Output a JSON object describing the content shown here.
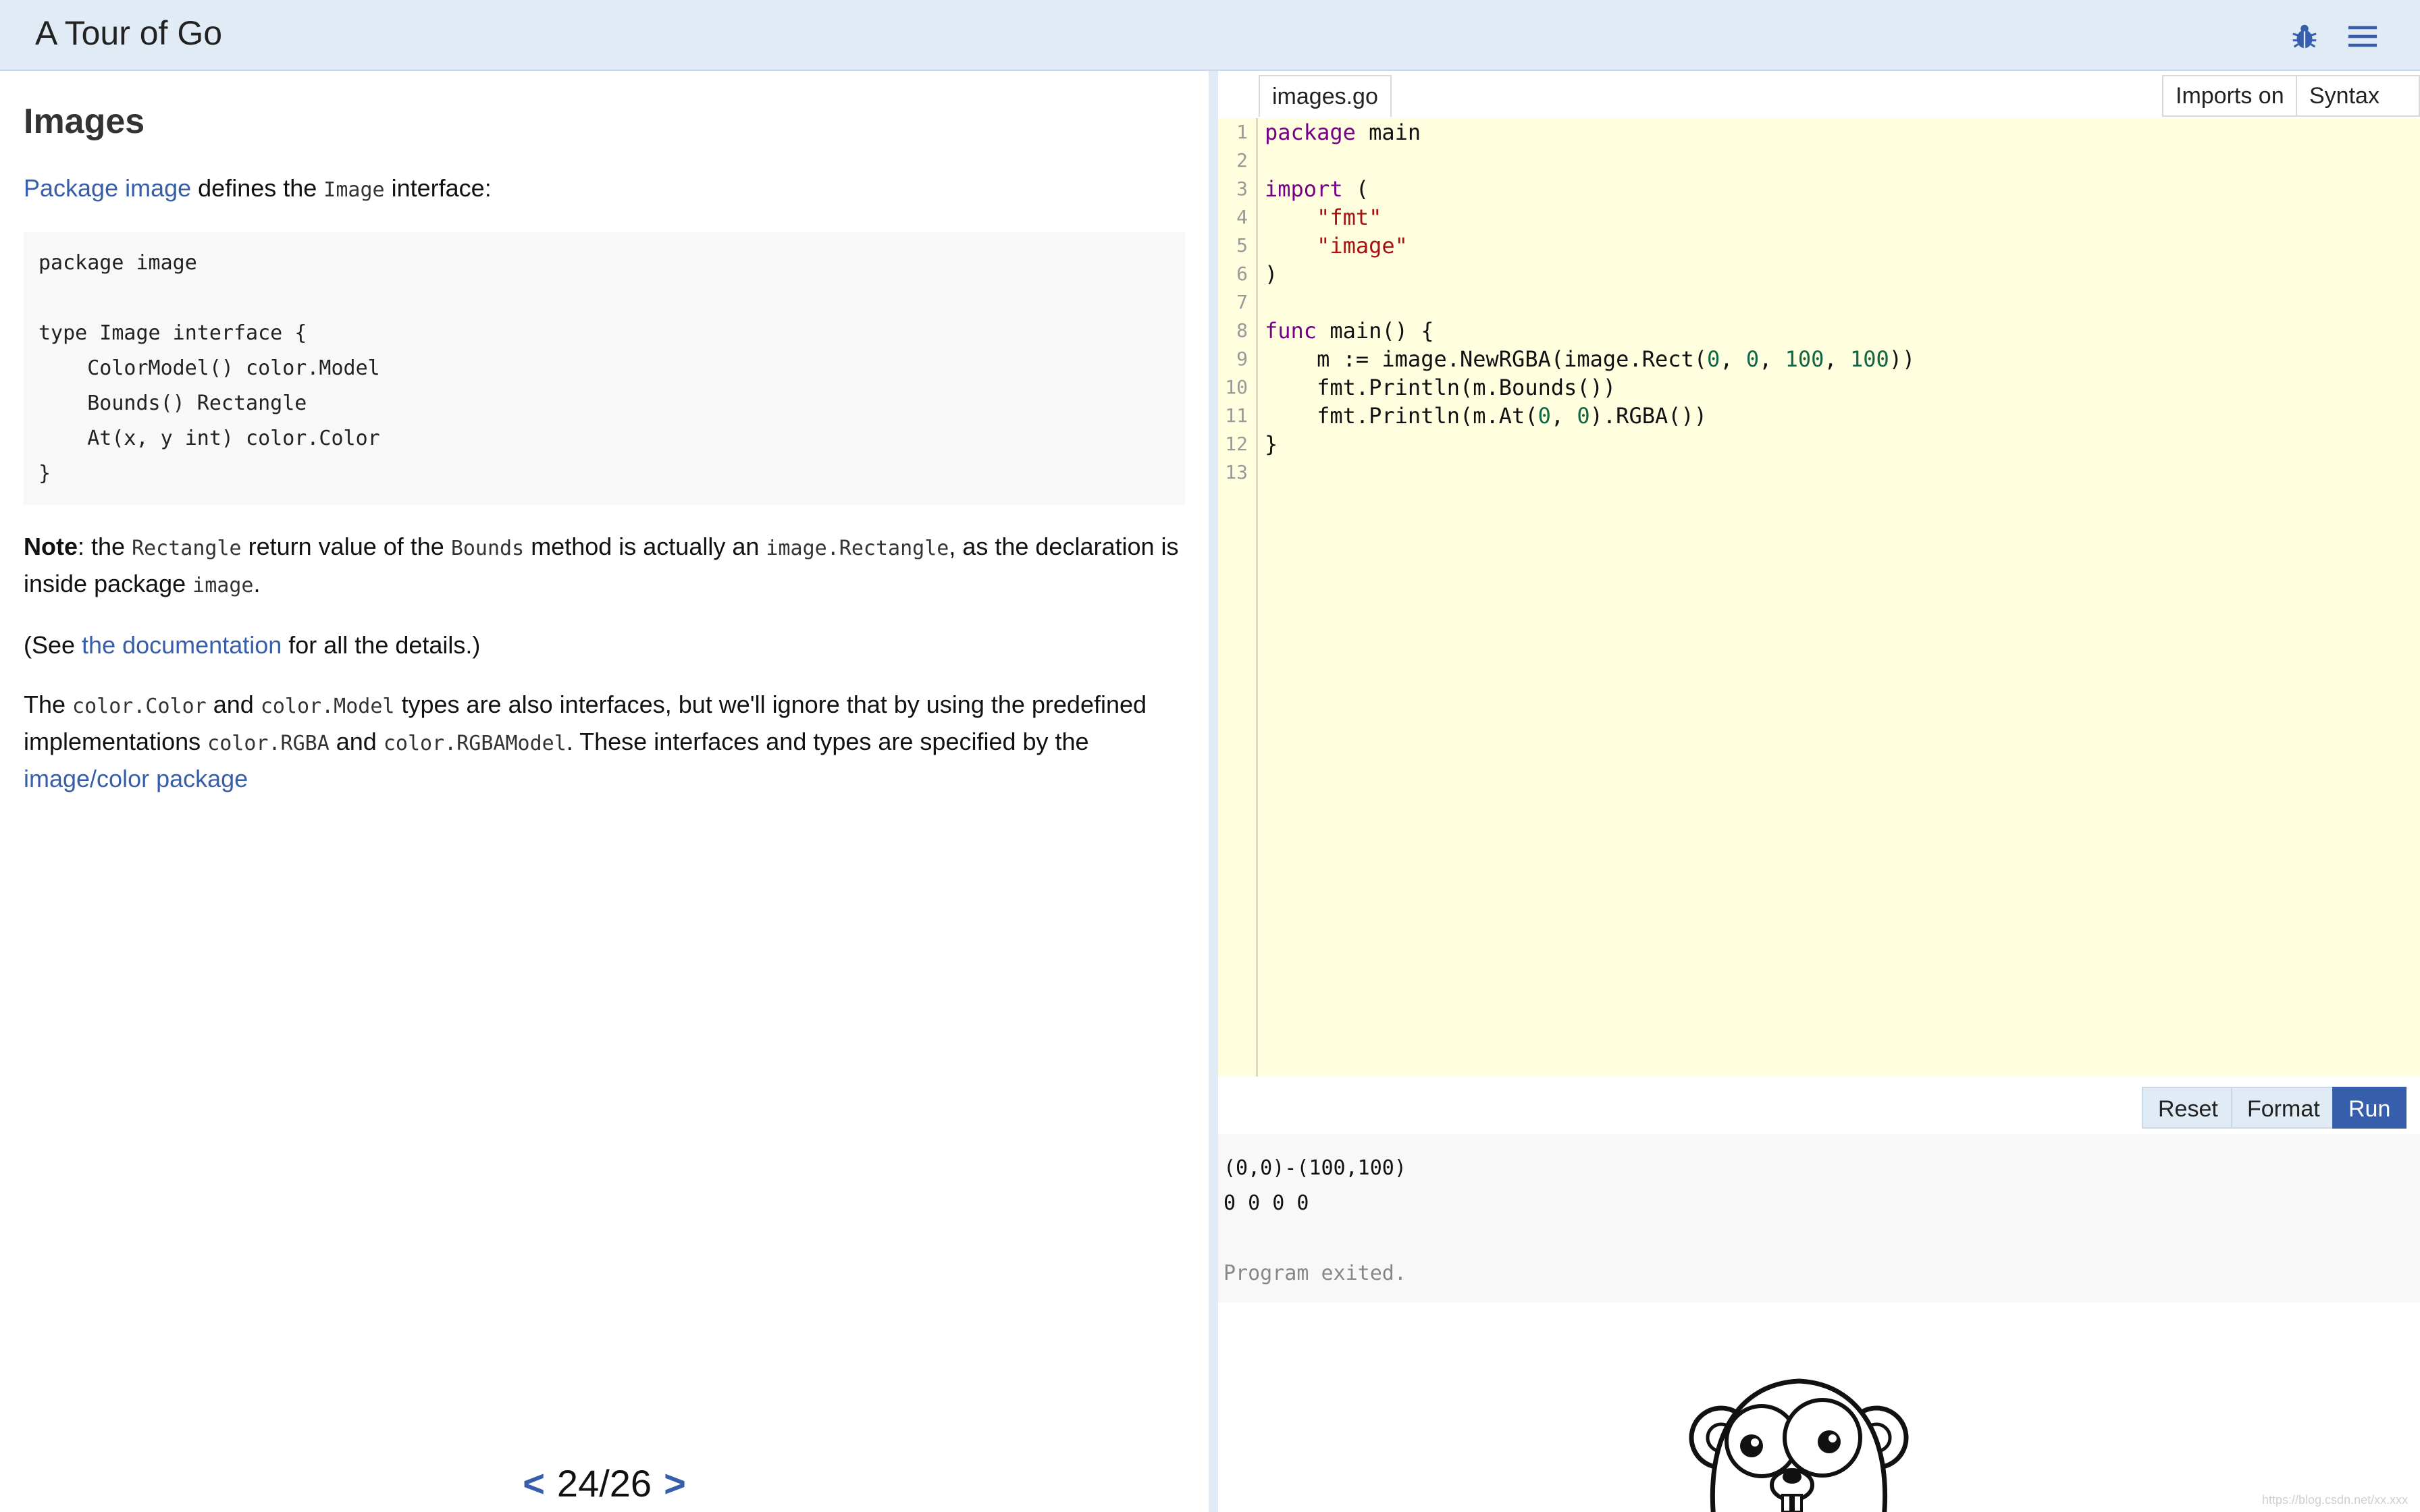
{
  "header": {
    "title": "A Tour of Go",
    "bug_icon": "bug-icon",
    "menu_icon": "hamburger-menu-icon"
  },
  "lesson": {
    "heading": "Images",
    "p1": {
      "link": "Package image",
      "t1": " defines the ",
      "code": "Image",
      "t2": " interface:"
    },
    "code_block": "package image\n\ntype Image interface {\n    ColorModel() color.Model\n    Bounds() Rectangle\n    At(x, y int) color.Color\n}",
    "note": {
      "bold": "Note",
      "t1": ": the ",
      "c1": "Rectangle",
      "t2": " return value of the ",
      "c2": "Bounds",
      "t3": " method is actually an ",
      "c3": "image.Rectangle",
      "t4": ", as the declaration is inside package ",
      "c4": "image",
      "t5": "."
    },
    "see": {
      "t1": "(See ",
      "link": "the documentation",
      "t2": " for all the details.)"
    },
    "types": {
      "t1": "The ",
      "c1": "color.Color",
      "t2": " and ",
      "c2": "color.Model",
      "t3": " types are also interfaces, but we'll ignore that by using the predefined implementations ",
      "c3": "color.RGBA",
      "t4": " and ",
      "c4": "color.RGBAModel",
      "t5": ". These interfaces and types are specified by the ",
      "link": "image/color package"
    }
  },
  "pager": {
    "prev": "<",
    "label": "24/26",
    "next": ">"
  },
  "editor": {
    "file_tab": "images.go",
    "imports_toggle": "Imports on",
    "syntax_toggle": "Syntax on",
    "line_numbers": [
      "1",
      "2",
      "3",
      "4",
      "5",
      "6",
      "7",
      "8",
      "9",
      "10",
      "11",
      "12",
      "13"
    ],
    "code": {
      "l1_kw": "package",
      "l1_rest": " main",
      "l3_kw": "import",
      "l3_rest": " (",
      "l4_str": "\"fmt\"",
      "l5_str": "\"image\"",
      "l6": ")",
      "l8_kw": "func",
      "l8_rest": " main() {",
      "l9_a": "    m := image.NewRGBA(image.Rect(",
      "l9_n1": "0",
      "l9_s1": ", ",
      "l9_n2": "0",
      "l9_s2": ", ",
      "l9_n3": "100",
      "l9_s3": ", ",
      "l9_n4": "100",
      "l9_end": "))",
      "l10": "    fmt.Println(m.Bounds())",
      "l11_a": "    fmt.Println(m.At(",
      "l11_n1": "0",
      "l11_s": ", ",
      "l11_n2": "0",
      "l11_end": ").RGBA())",
      "l12": "}"
    }
  },
  "controls": {
    "reset": "Reset",
    "format": "Format",
    "run": "Run"
  },
  "output": {
    "line1": "(0,0)-(100,100)",
    "line2": "0 0 0 0",
    "exit": "Program exited."
  },
  "watermark": "https://blog.csdn.net/xx.xxx"
}
